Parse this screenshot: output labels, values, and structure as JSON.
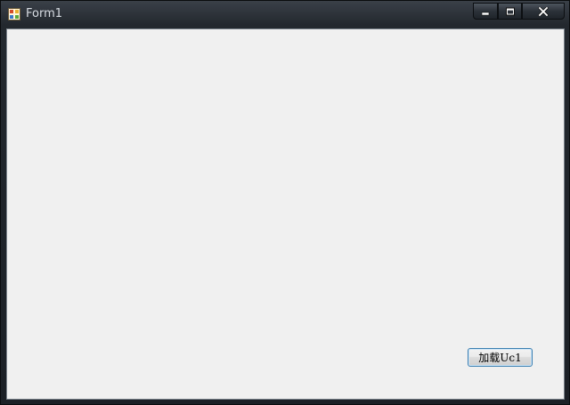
{
  "window": {
    "title": "Form1",
    "icon": "form-app-icon",
    "caption_buttons": {
      "minimize_icon": "minimize-icon",
      "maximize_icon": "maximize-icon",
      "close_icon": "close-icon"
    }
  },
  "client": {
    "background": "#f0f0f0",
    "load_button_label": "加载Uc1"
  }
}
